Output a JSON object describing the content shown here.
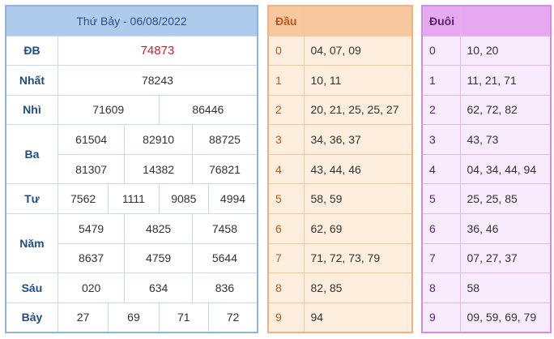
{
  "main": {
    "title": "Thứ Bảy - 06/08/2022",
    "rows": {
      "db": {
        "label": "ĐB",
        "values": [
          "74873"
        ]
      },
      "nhat": {
        "label": "Nhất",
        "values": [
          "78243"
        ]
      },
      "nhi": {
        "label": "Nhì",
        "values": [
          "71609",
          "86446"
        ]
      },
      "ba": {
        "label": "Ba",
        "values": [
          "61504",
          "82910",
          "88725",
          "81307",
          "14382",
          "76821"
        ]
      },
      "tu": {
        "label": "Tư",
        "values": [
          "7562",
          "1111",
          "9085",
          "4994"
        ]
      },
      "nam": {
        "label": "Năm",
        "values": [
          "5479",
          "4825",
          "7458",
          "8637",
          "4759",
          "5644"
        ]
      },
      "sau": {
        "label": "Sáu",
        "values": [
          "020",
          "634",
          "836"
        ]
      },
      "bay": {
        "label": "Bảy",
        "values": [
          "27",
          "69",
          "71",
          "72"
        ]
      }
    }
  },
  "dau": {
    "header": "Đầu",
    "rows": [
      {
        "k": "0",
        "v": "04, 07, 09"
      },
      {
        "k": "1",
        "v": "10, 11"
      },
      {
        "k": "2",
        "v": "20, 21, 25, 25, 27"
      },
      {
        "k": "3",
        "v": "34, 36, 37"
      },
      {
        "k": "4",
        "v": "43, 44, 46"
      },
      {
        "k": "5",
        "v": "58, 59"
      },
      {
        "k": "6",
        "v": "62, 69"
      },
      {
        "k": "7",
        "v": "71, 72, 73, 79"
      },
      {
        "k": "8",
        "v": "82, 85"
      },
      {
        "k": "9",
        "v": "94"
      }
    ]
  },
  "duoi": {
    "header": "Đuôi",
    "rows": [
      {
        "k": "0",
        "v": "10, 20"
      },
      {
        "k": "1",
        "v": "11, 21, 71"
      },
      {
        "k": "2",
        "v": "62, 72, 82"
      },
      {
        "k": "3",
        "v": "43, 73"
      },
      {
        "k": "4",
        "v": "04, 34, 44, 94"
      },
      {
        "k": "5",
        "v": "25, 25, 85"
      },
      {
        "k": "6",
        "v": "36, 46"
      },
      {
        "k": "7",
        "v": "07, 27, 37"
      },
      {
        "k": "8",
        "v": "58"
      },
      {
        "k": "9",
        "v": "09, 59, 69, 79"
      }
    ]
  },
  "colors": {
    "special_prize": "#d7192a",
    "main_header": "#aecbeb",
    "dau_header": "#f7c79f",
    "duoi_header": "#e6a9ef"
  }
}
